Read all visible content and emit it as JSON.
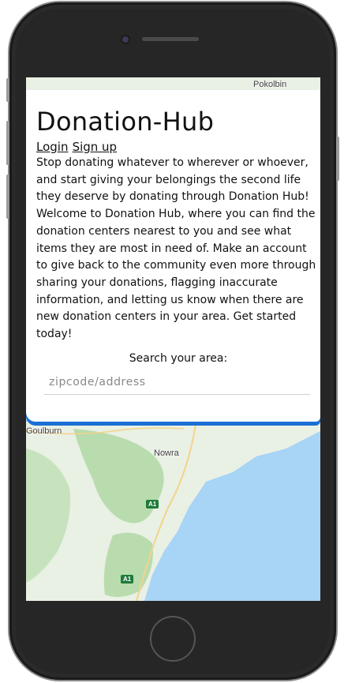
{
  "app": {
    "title": "Donation-Hub"
  },
  "nav": {
    "login_label": "Login",
    "signup_label": "Sign up"
  },
  "intro": {
    "text": "Stop donating whatever to wherever or whoever, and start giving your belongings the second life they deserve by donating through Donation Hub! Welcome to Donation Hub, where you can find the donation centers nearest to you and see what items they are most in need of. Make an account to give back to the community even more through sharing your donations, flagging inaccurate information, and letting us know when there are new donation centers in your area. Get started today!"
  },
  "search": {
    "label": "Search your area:",
    "placeholder": "zipcode/address",
    "value": ""
  },
  "map": {
    "labels": {
      "pokolbin": "Pokolbin",
      "goulburn": "Goulburn",
      "nowra": "Nowra"
    },
    "road_shields": {
      "a1_north": "A1",
      "a1_south": "A1"
    }
  },
  "colors": {
    "accent": "#1a6fd4",
    "water": "#a8d4f6",
    "land": "#e9f0e4",
    "forest": "#b8dcae"
  }
}
